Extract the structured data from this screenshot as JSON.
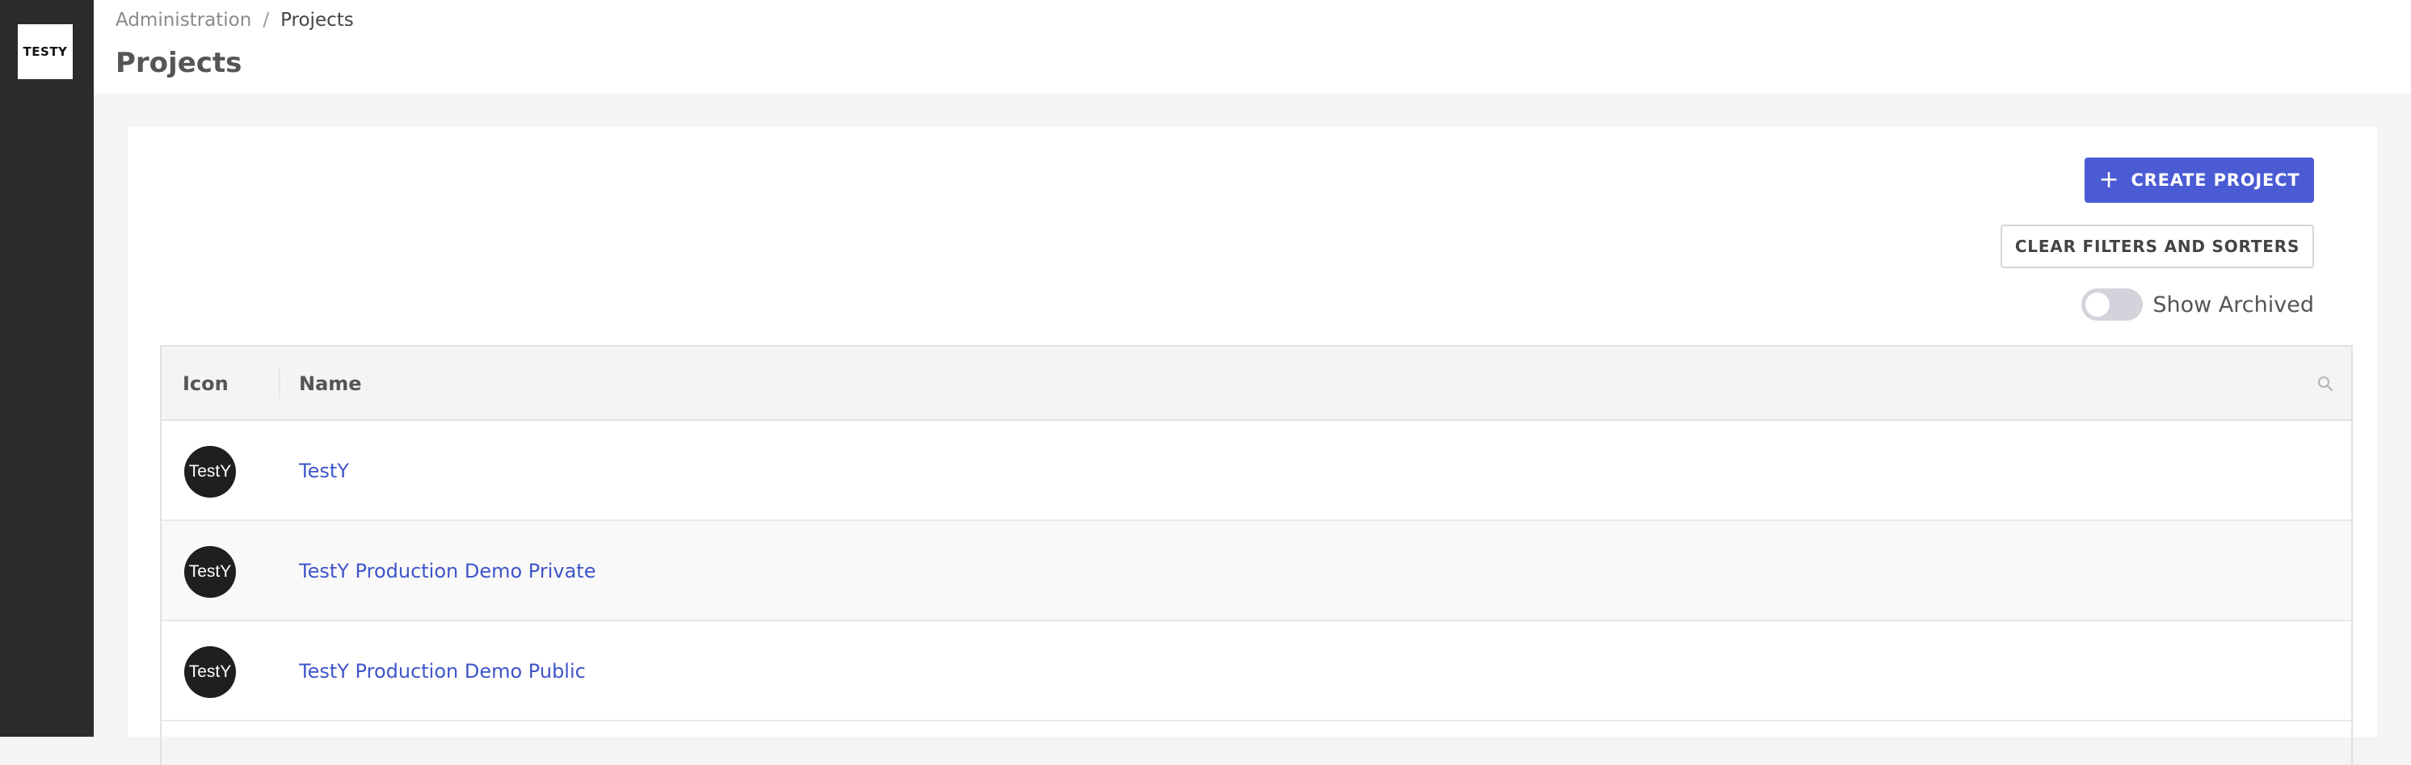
{
  "sidebar": {
    "logo_text": "TESTY"
  },
  "header": {
    "breadcrumb": [
      "Administration",
      "/",
      "Projects"
    ],
    "title": "Projects"
  },
  "toolbar": {
    "create_label": "CREATE PROJECT",
    "create_icon": "plus-icon",
    "clear_label": "CLEAR FILTERS AND SORTERS",
    "archived_label": "Show Archived",
    "archived_on": false
  },
  "table": {
    "columns": [
      "Icon",
      "Name"
    ],
    "search_icon": "search-icon",
    "rows": [
      {
        "avatar": "TestY",
        "name": "TestY"
      },
      {
        "avatar": "TestY",
        "name": "TestY Production Demo Private"
      },
      {
        "avatar": "TestY",
        "name": "TestY Production Demo Public"
      }
    ]
  },
  "colors": {
    "sidebar": "#2b2b2b",
    "accent": "#4a5bd4",
    "link": "#3f55c8"
  }
}
